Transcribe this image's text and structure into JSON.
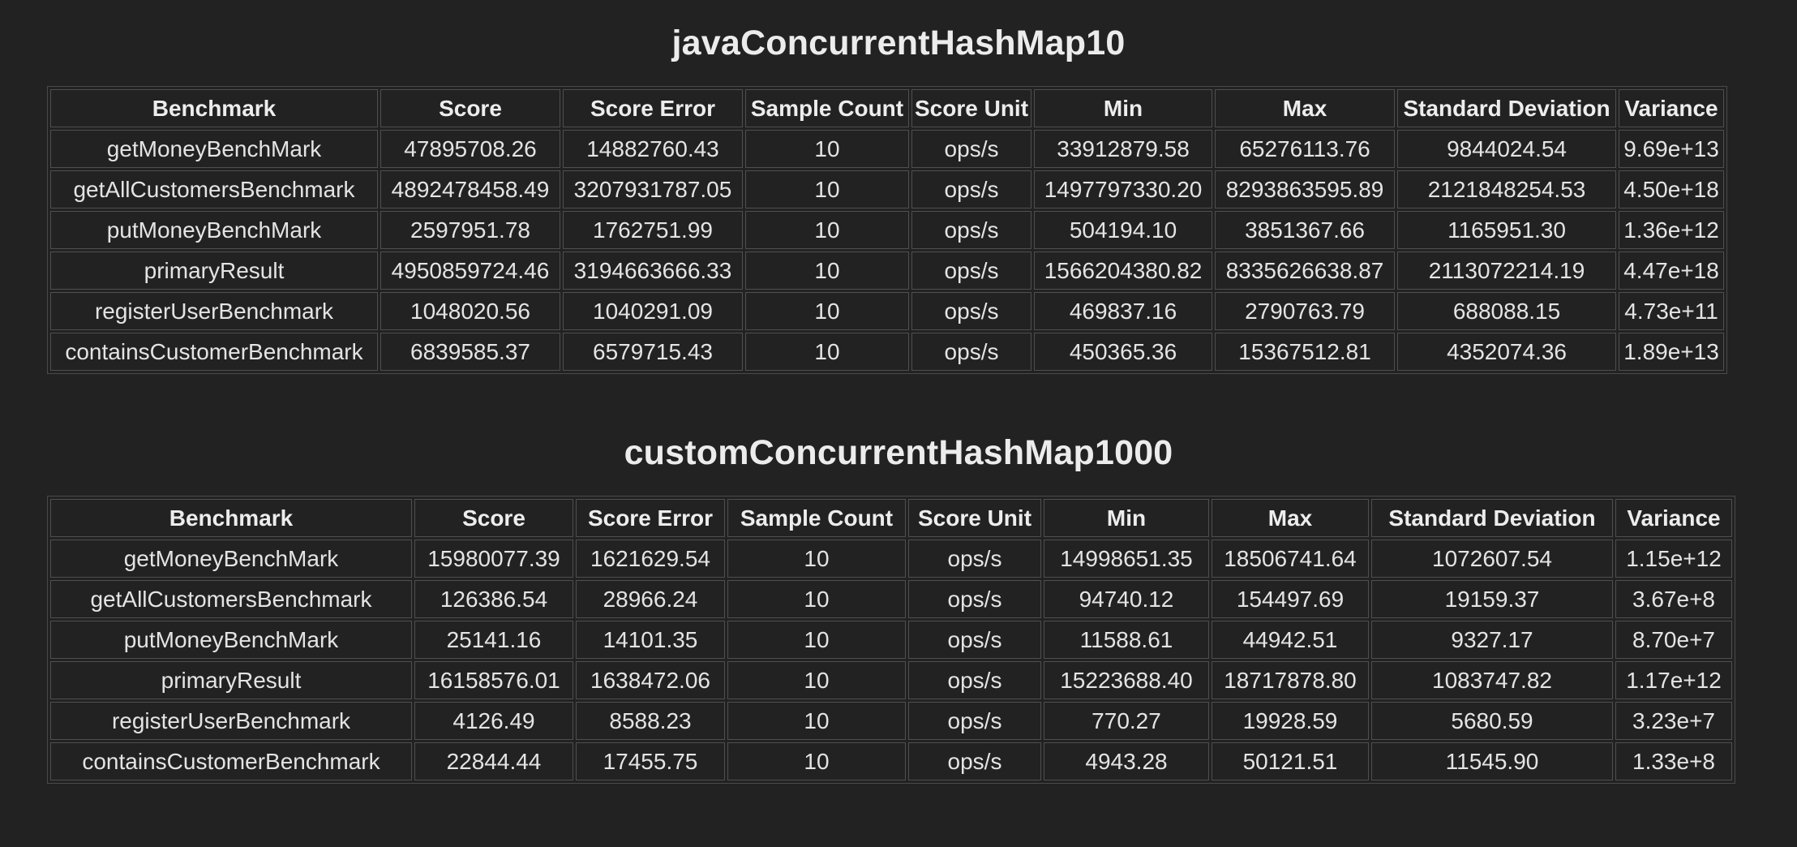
{
  "tables": [
    {
      "title": "javaConcurrentHashMap10",
      "headers": [
        "Benchmark",
        "Score",
        "Score Error",
        "Sample Count",
        "Score Unit",
        "Min",
        "Max",
        "Standard Deviation",
        "Variance"
      ],
      "rows": [
        [
          "getMoneyBenchMark",
          "47895708.26",
          "14882760.43",
          "10",
          "ops/s",
          "33912879.58",
          "65276113.76",
          "9844024.54",
          "9.69e+13"
        ],
        [
          "getAllCustomersBenchmark",
          "4892478458.49",
          "3207931787.05",
          "10",
          "ops/s",
          "1497797330.20",
          "8293863595.89",
          "2121848254.53",
          "4.50e+18"
        ],
        [
          "putMoneyBenchMark",
          "2597951.78",
          "1762751.99",
          "10",
          "ops/s",
          "504194.10",
          "3851367.66",
          "1165951.30",
          "1.36e+12"
        ],
        [
          "primaryResult",
          "4950859724.46",
          "3194663666.33",
          "10",
          "ops/s",
          "1566204380.82",
          "8335626638.87",
          "2113072214.19",
          "4.47e+18"
        ],
        [
          "registerUserBenchmark",
          "1048020.56",
          "1040291.09",
          "10",
          "ops/s",
          "469837.16",
          "2790763.79",
          "688088.15",
          "4.73e+11"
        ],
        [
          "containsCustomerBenchmark",
          "6839585.37",
          "6579715.43",
          "10",
          "ops/s",
          "450365.36",
          "15367512.81",
          "4352074.36",
          "1.89e+13"
        ]
      ]
    },
    {
      "title": "customConcurrentHashMap1000",
      "headers": [
        "Benchmark",
        "Score",
        "Score Error",
        "Sample Count",
        "Score Unit",
        "Min",
        "Max",
        "Standard Deviation",
        "Variance"
      ],
      "rows": [
        [
          "getMoneyBenchMark",
          "15980077.39",
          "1621629.54",
          "10",
          "ops/s",
          "14998651.35",
          "18506741.64",
          "1072607.54",
          "1.15e+12"
        ],
        [
          "getAllCustomersBenchmark",
          "126386.54",
          "28966.24",
          "10",
          "ops/s",
          "94740.12",
          "154497.69",
          "19159.37",
          "3.67e+8"
        ],
        [
          "putMoneyBenchMark",
          "25141.16",
          "14101.35",
          "10",
          "ops/s",
          "11588.61",
          "44942.51",
          "9327.17",
          "8.70e+7"
        ],
        [
          "primaryResult",
          "16158576.01",
          "1638472.06",
          "10",
          "ops/s",
          "15223688.40",
          "18717878.80",
          "1083747.82",
          "1.17e+12"
        ],
        [
          "registerUserBenchmark",
          "4126.49",
          "8588.23",
          "10",
          "ops/s",
          "770.27",
          "19928.59",
          "5680.59",
          "3.23e+7"
        ],
        [
          "containsCustomerBenchmark",
          "22844.44",
          "17455.75",
          "10",
          "ops/s",
          "4943.28",
          "50121.51",
          "11545.90",
          "1.33e+8"
        ]
      ]
    }
  ]
}
